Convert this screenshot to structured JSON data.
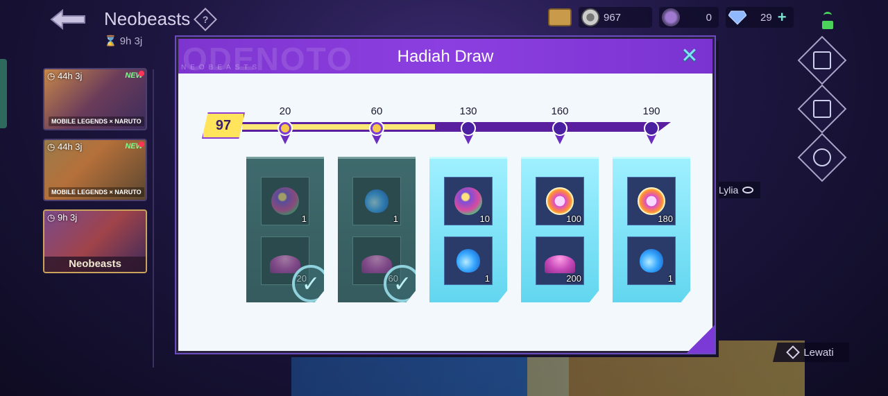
{
  "header": {
    "title": "Neobeasts",
    "timer": "9h 3j"
  },
  "currencies": [
    {
      "icon": "draw-token-icon",
      "value": "967"
    },
    {
      "icon": "crystal-icon",
      "value": "0"
    },
    {
      "icon": "diamond-icon",
      "value": "29"
    }
  ],
  "event_tabs": [
    {
      "timer": "44h 3j",
      "badge": "NEW",
      "logo": "MOBILE LEGENDS × NARUTO",
      "label": ""
    },
    {
      "timer": "44h 3j",
      "badge": "NEW",
      "logo": "MOBILE LEGENDS × NARUTO",
      "label": ""
    },
    {
      "timer": "9h 3j",
      "badge": "",
      "logo": "",
      "label": "Neobeasts"
    }
  ],
  "hero_label": "Lylia",
  "skip_label": "Lewati",
  "modal": {
    "title": "Hadiah Draw",
    "watermark": "ODENOTO",
    "watermark_sub": "NEOBEASTS",
    "current_count": "97",
    "milestones": [
      "20",
      "60",
      "130",
      "160",
      "190"
    ],
    "progress_fraction": 0.45,
    "cards": [
      {
        "state": "claimed",
        "rewards": [
          {
            "icon": "crystal-icon",
            "qty": "1"
          },
          {
            "icon": "magic-dust-icon",
            "qty": "20"
          }
        ]
      },
      {
        "state": "claimed",
        "rewards": [
          {
            "icon": "potion-icon",
            "qty": "1"
          },
          {
            "icon": "magic-dust-icon",
            "qty": "60"
          }
        ]
      },
      {
        "state": "open",
        "rewards": [
          {
            "icon": "crystal-icon",
            "qty": "10"
          },
          {
            "icon": "potion-icon",
            "qty": "1"
          }
        ]
      },
      {
        "state": "open",
        "rewards": [
          {
            "icon": "draw-token-icon",
            "qty": "100"
          },
          {
            "icon": "magic-dust-icon",
            "qty": "200"
          }
        ]
      },
      {
        "state": "open",
        "rewards": [
          {
            "icon": "draw-token-icon",
            "qty": "180"
          },
          {
            "icon": "potion-icon",
            "qty": "1"
          }
        ]
      }
    ]
  }
}
